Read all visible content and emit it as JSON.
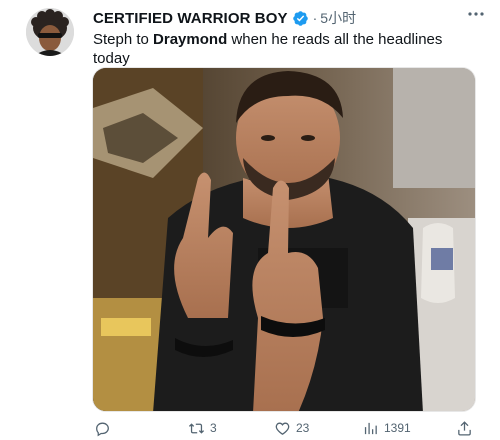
{
  "tweet": {
    "author_name": "CERTIFIED WARRIOR BOY",
    "separator": "·",
    "time": "5小时",
    "text_part1": "Steph to ",
    "text_bold": "Draymond",
    "text_part2": " when he reads all the headlines today",
    "actions": {
      "reply_count": "",
      "retweet_count": "3",
      "like_count": "23",
      "views_count": "1391"
    }
  },
  "colors": {
    "verified": "#1d9bf0",
    "muted": "#536471",
    "text": "#0f1419"
  },
  "icons": {
    "verified": "verified-badge-icon",
    "more": "more-dots-icon",
    "reply": "reply-icon",
    "retweet": "retweet-icon",
    "like": "heart-icon",
    "views": "views-chart-icon",
    "share": "share-icon"
  }
}
